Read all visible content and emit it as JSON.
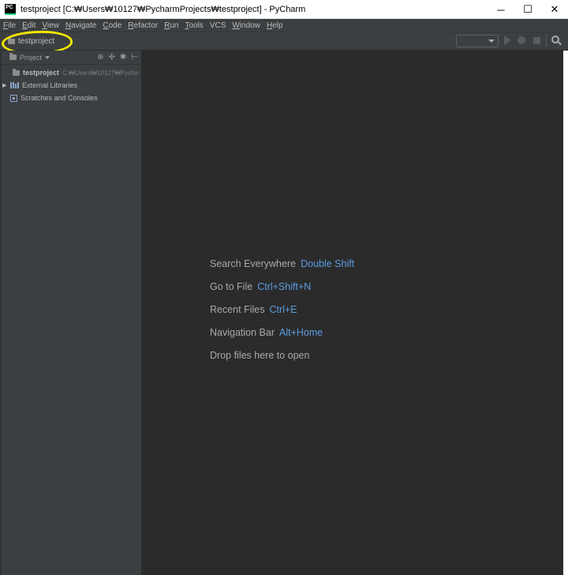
{
  "titlebar": {
    "logo_text": "PC",
    "title": "testproject [C:₩Users₩10127₩PycharmProjects₩testproject] - PyCharm",
    "minimize": "─",
    "maximize": "☐",
    "close": "✕"
  },
  "menu": [
    {
      "u": "F",
      "rest": "ile"
    },
    {
      "u": "E",
      "rest": "dit"
    },
    {
      "u": "V",
      "rest": "iew"
    },
    {
      "u": "N",
      "rest": "avigate"
    },
    {
      "u": "C",
      "rest": "ode"
    },
    {
      "u": "R",
      "rest": "efactor"
    },
    {
      "u": "R",
      "rest": "un"
    },
    {
      "u": "T",
      "rest": "ools"
    },
    {
      "u": "",
      "rest": "VCS"
    },
    {
      "u": "W",
      "rest": "indow"
    },
    {
      "u": "H",
      "rest": "elp"
    }
  ],
  "navbar": {
    "breadcrumb": "testproject",
    "highlight_color": "#f2e600"
  },
  "project_panel": {
    "title": "Project",
    "header_icons": [
      "⊕",
      "✣",
      "✱",
      "⊢"
    ],
    "tree": [
      {
        "label": "testproject",
        "path": "C:₩Users₩10127₩Pycha",
        "icon": "folder-icon"
      },
      {
        "label": "External Libraries",
        "icon": "library-icon",
        "arrow": "▶"
      },
      {
        "label": "Scratches and Consoles",
        "icon": "scratch-icon"
      }
    ]
  },
  "editor": {
    "hints": [
      {
        "label": "Search Everywhere",
        "key": "Double Shift"
      },
      {
        "label": "Go to File",
        "key": "Ctrl+Shift+N"
      },
      {
        "label": "Recent Files",
        "key": "Ctrl+E"
      },
      {
        "label": "Navigation Bar",
        "key": "Alt+Home"
      },
      {
        "label": "Drop files here to open",
        "key": ""
      }
    ],
    "key_color": "#5c9ce0"
  }
}
